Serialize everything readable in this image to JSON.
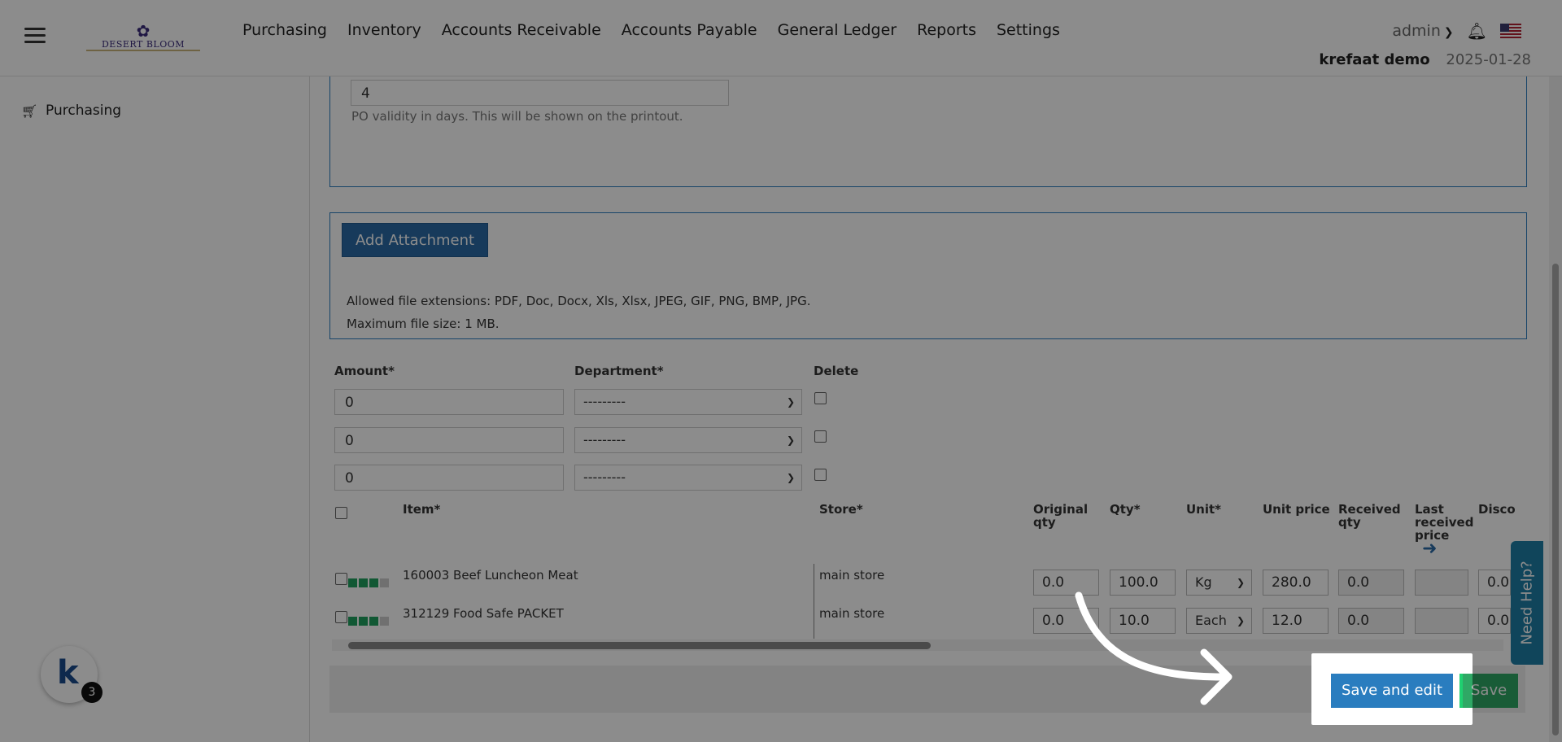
{
  "brand": {
    "logo_text": "DESERT BLOOM"
  },
  "nav": {
    "items": [
      "Purchasing",
      "Inventory",
      "Accounts Receivable",
      "Accounts Payable",
      "General Ledger",
      "Reports",
      "Settings"
    ]
  },
  "user": {
    "name": "admin",
    "company": "krefaat demo",
    "date": "2025-01-28"
  },
  "sidebar": {
    "items": [
      {
        "label": "Purchasing"
      }
    ]
  },
  "validity": {
    "value": "4",
    "help": "PO validity in days. This will be shown on the printout."
  },
  "attachment": {
    "button_label": "Add Attachment",
    "allowed_text": "Allowed file extensions: PDF, Doc, Docx, Xls, Xlsx, JPEG, GIF, PNG, BMP, JPG.",
    "max_size_text": "Maximum file size: 1 MB."
  },
  "allocation": {
    "headers": {
      "amount": "Amount*",
      "department": "Department*",
      "delete": "Delete"
    },
    "rows": [
      {
        "amount": "0",
        "department": "---------"
      },
      {
        "amount": "0",
        "department": "---------"
      },
      {
        "amount": "0",
        "department": "---------"
      }
    ]
  },
  "items_table": {
    "headers": {
      "item": "Item*",
      "store": "Store*",
      "original_qty": "Original qty",
      "qty": "Qty*",
      "unit": "Unit*",
      "unit_price": "Unit price",
      "received_qty": "Received qty",
      "last_received_price": "Last received price",
      "discount": "Disco"
    },
    "rows": [
      {
        "item": "160003 Beef Luncheon Meat",
        "store": "main store",
        "original_qty": "0.0",
        "qty": "100.0",
        "unit": "Kg",
        "unit_price": "280.0",
        "received_qty": "0.0",
        "last_received_price": "",
        "discount": "0.0"
      },
      {
        "item": "312129 Food Safe PACKET",
        "store": "main store",
        "original_qty": "0.0",
        "qty": "10.0",
        "unit": "Each",
        "unit_price": "12.0",
        "received_qty": "0.0",
        "last_received_price": "",
        "discount": "0.0"
      }
    ]
  },
  "actions": {
    "save_and_edit": "Save and edit",
    "save": "Save"
  },
  "need_help": "Need Help?",
  "badge": {
    "count": "3"
  }
}
